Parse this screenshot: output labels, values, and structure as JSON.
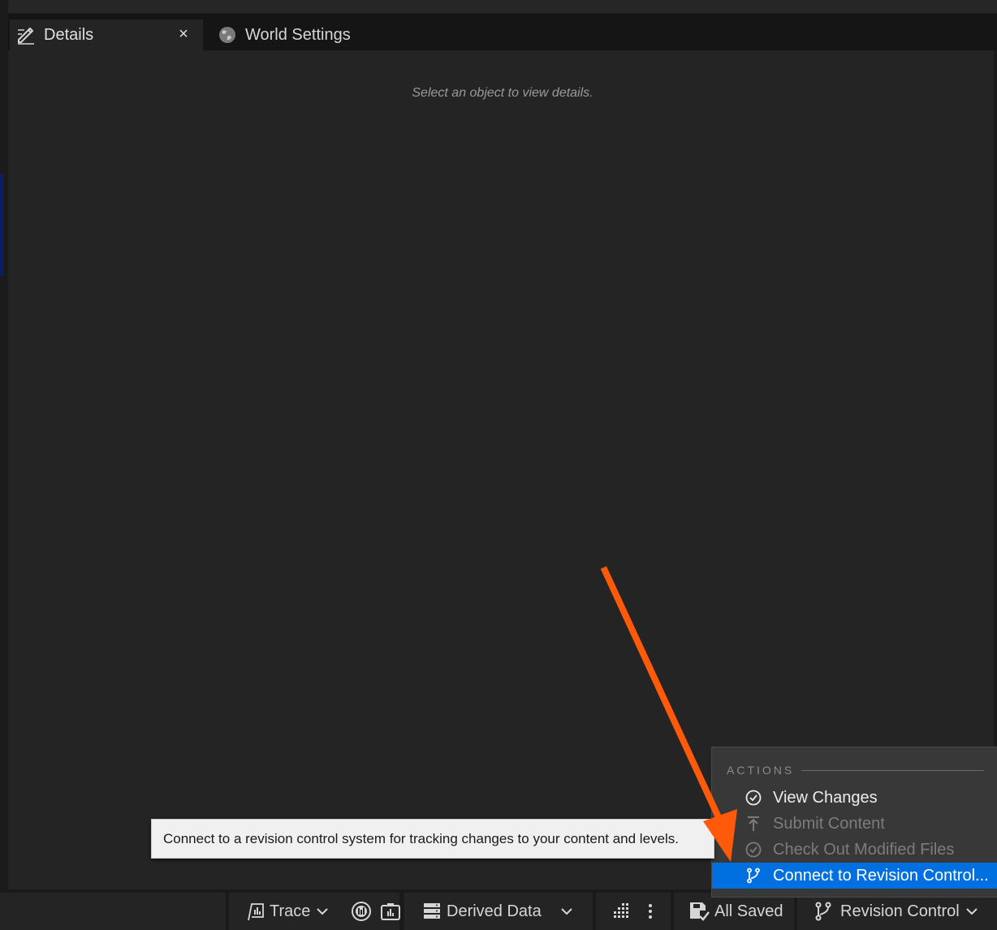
{
  "tabs": [
    {
      "label": "Details",
      "active": true,
      "close_label": "×"
    },
    {
      "label": "World Settings",
      "active": false
    }
  ],
  "details": {
    "empty_message": "Select an object to view details."
  },
  "status_bar": {
    "trace_label": "Trace",
    "derived_data_label": "Derived Data",
    "save_status_label": "All Saved",
    "revision_control_label": "Revision Control"
  },
  "menu": {
    "section_header": "ACTIONS",
    "items": [
      {
        "label": "View Changes",
        "state": "enabled",
        "icon": "check-circle-icon"
      },
      {
        "label": "Submit Content",
        "state": "disabled",
        "icon": "upload-arrow-icon"
      },
      {
        "label": "Check Out Modified Files",
        "state": "disabled",
        "icon": "check-circle-icon"
      },
      {
        "label": "Connect to Revision Control...",
        "state": "highlighted",
        "icon": "branch-icon"
      }
    ]
  },
  "tooltip": {
    "text": "Connect to a revision control system for tracking changes to your content and levels."
  },
  "colors": {
    "panel_bg": "#242424",
    "menu_bg": "#383838",
    "highlight": "#0070e0",
    "annotation_arrow": "#ff5a0a"
  }
}
